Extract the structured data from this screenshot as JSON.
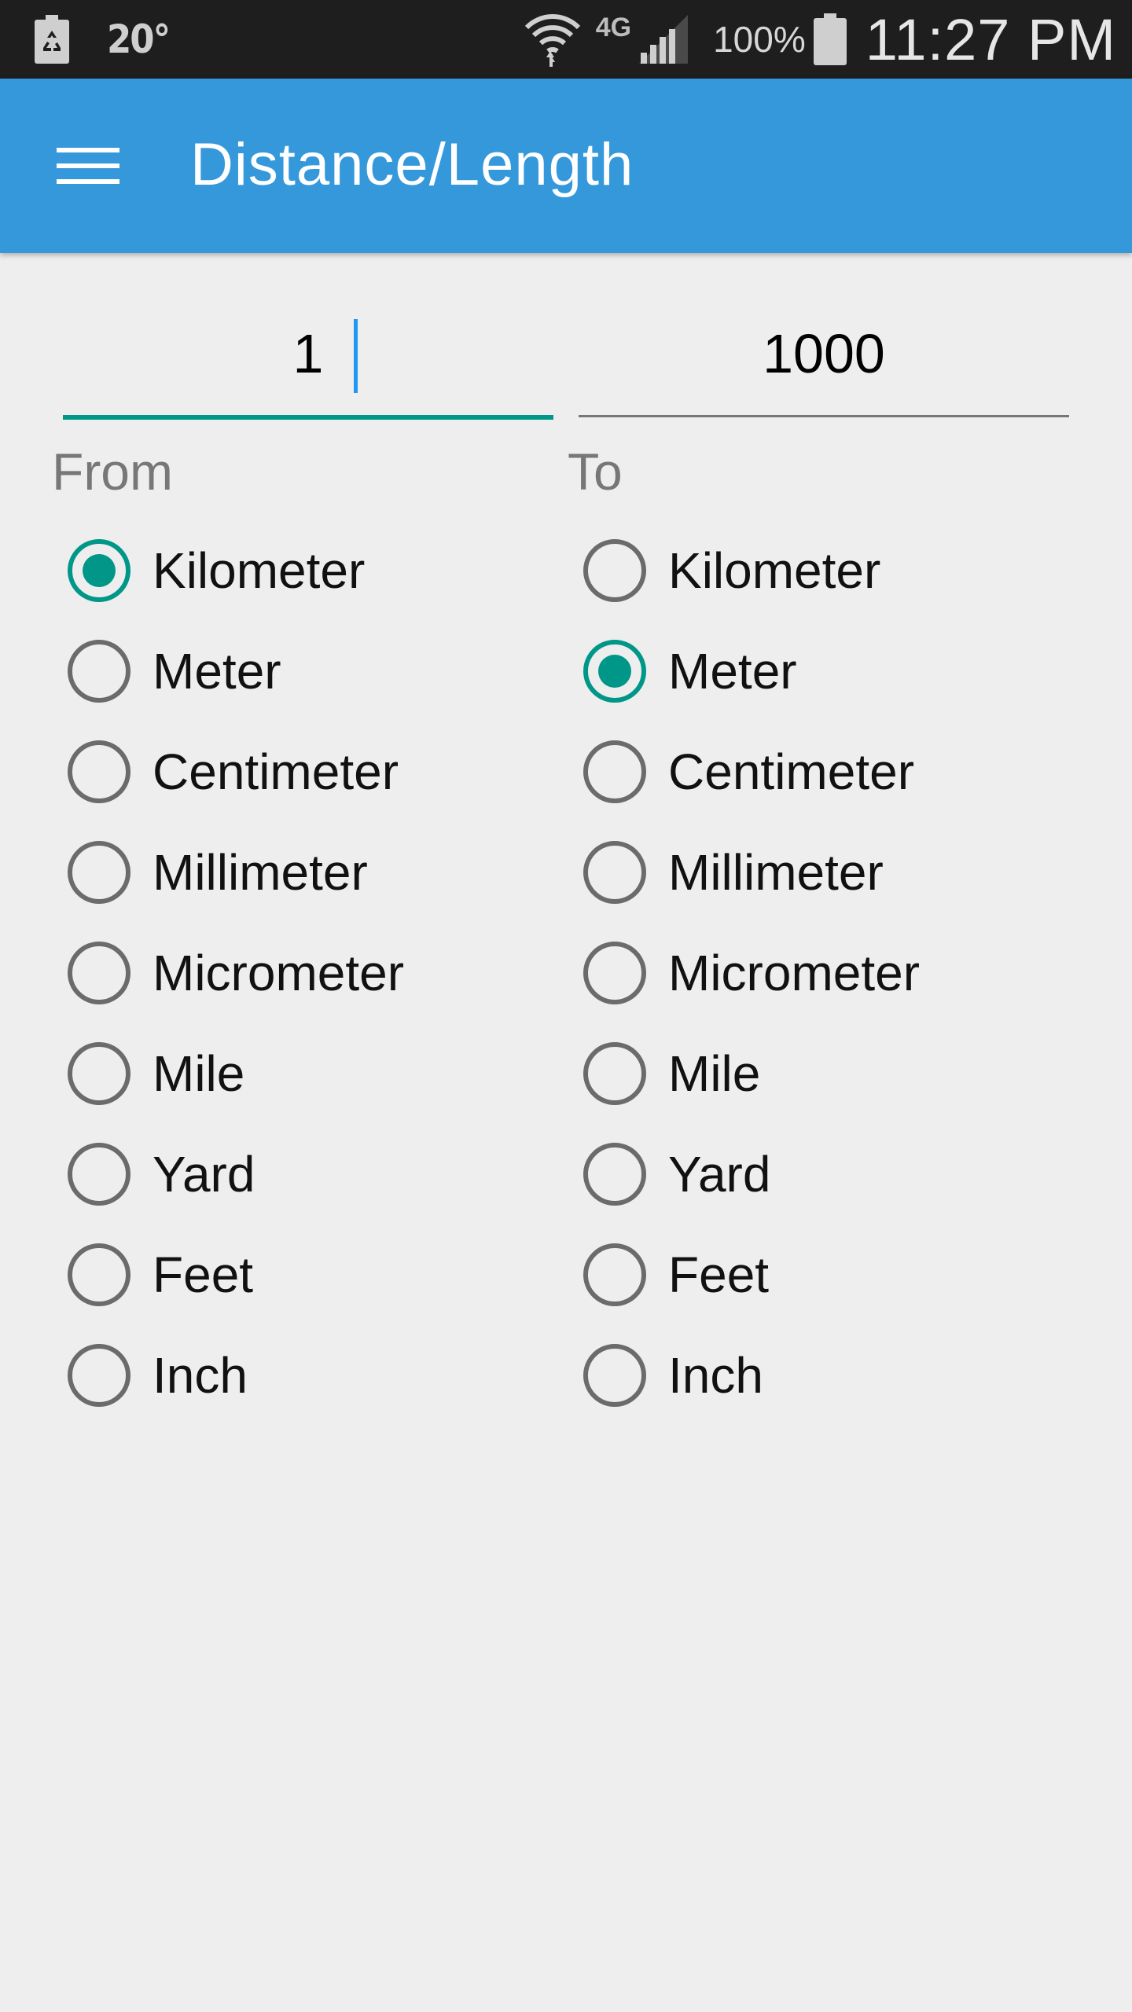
{
  "status_bar": {
    "temperature": "20°",
    "battery_percent": "100%",
    "time": "11:27 PM",
    "network": "4G"
  },
  "app_bar": {
    "title": "Distance/Length",
    "color": "#3498db"
  },
  "from": {
    "label": "From",
    "value": "1",
    "selected": "Kilometer"
  },
  "to": {
    "label": "To",
    "value": "1000",
    "selected": "Meter"
  },
  "units": [
    "Kilometer",
    "Meter",
    "Centimeter",
    "Millimeter",
    "Micrometer",
    "Mile",
    "Yard",
    "Feet",
    "Inch"
  ],
  "accent_color": "#009688"
}
